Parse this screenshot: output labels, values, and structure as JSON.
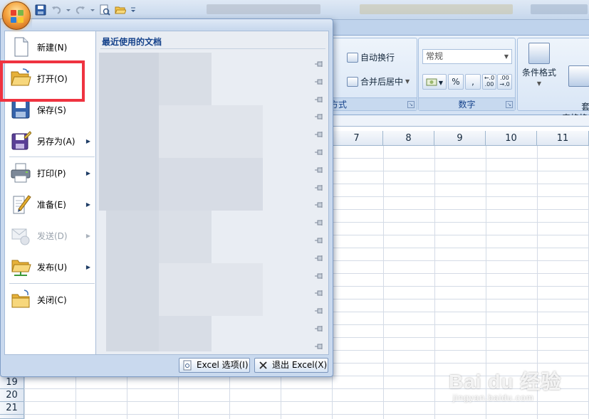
{
  "ribbon": {
    "alignment": {
      "wrap_text": "自动换行",
      "merge_center": "合并后居中",
      "group_label_partial": "方式"
    },
    "number": {
      "format_value": "常规",
      "percent": "%",
      "comma": ",",
      "inc_decimal": "←.0\n.00",
      "dec_decimal": ".00\n→.0",
      "group_label": "数字"
    },
    "styles": {
      "conditional_format": "条件格式",
      "table_format": "套用\n表格格式"
    }
  },
  "sheet": {
    "columns": [
      "7",
      "8",
      "9",
      "10",
      "11"
    ],
    "rows": [
      "19",
      "20",
      "21"
    ]
  },
  "menu": {
    "items": [
      {
        "label": "新建(N)",
        "icon": "new-document-icon",
        "has_sub": false
      },
      {
        "label": "打开(O)",
        "icon": "open-folder-icon",
        "has_sub": false
      },
      {
        "label": "保存(S)",
        "icon": "save-icon",
        "has_sub": false
      },
      {
        "label": "另存为(A)",
        "icon": "save-as-icon",
        "has_sub": true
      },
      {
        "label": "打印(P)",
        "icon": "print-icon",
        "has_sub": true
      },
      {
        "label": "准备(E)",
        "icon": "prepare-icon",
        "has_sub": true
      },
      {
        "label": "发送(D)",
        "icon": "send-icon",
        "has_sub": true,
        "disabled": true
      },
      {
        "label": "发布(U)",
        "icon": "publish-icon",
        "has_sub": true
      },
      {
        "label": "关闭(C)",
        "icon": "close-folder-icon",
        "has_sub": false
      }
    ],
    "recent_title": "最近使用的文档",
    "excel_options": "Excel 选项(I)",
    "exit_excel": "退出 Excel(X)"
  },
  "watermark": {
    "main": "Bai du 经验",
    "sub": "jingyan.baidu.com"
  },
  "colors": {
    "highlight": "#ef3340",
    "menu_bg": "#c9d9ee",
    "ribbon_label": "#15428b"
  }
}
